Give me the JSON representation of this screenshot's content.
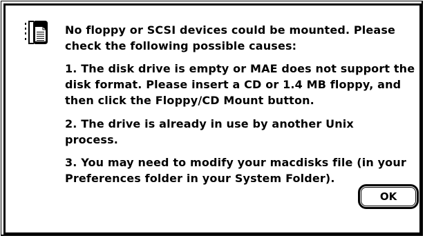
{
  "alert": {
    "icon": "alert-document-icon",
    "header_line1": "No floppy or SCSI devices could be mounted. Please",
    "header_line2": "check the following possible causes:",
    "cause1_line1": "1. The disk drive is empty or MAE does not support the",
    "cause1_line2": "disk format. Please insert a CD or 1.4 MB floppy, and",
    "cause1_line3": "then click the Floppy/CD Mount button.",
    "cause2_line1": "2. The drive is already in use by another Unix",
    "cause2_line2": "process.",
    "cause3_line1": "3. You may need to modify your macdisks file (in your",
    "cause3_line2": "Preferences folder in your System Folder).",
    "ok_label": "OK"
  },
  "colors": {
    "background": "#ffffff",
    "foreground": "#000000"
  }
}
